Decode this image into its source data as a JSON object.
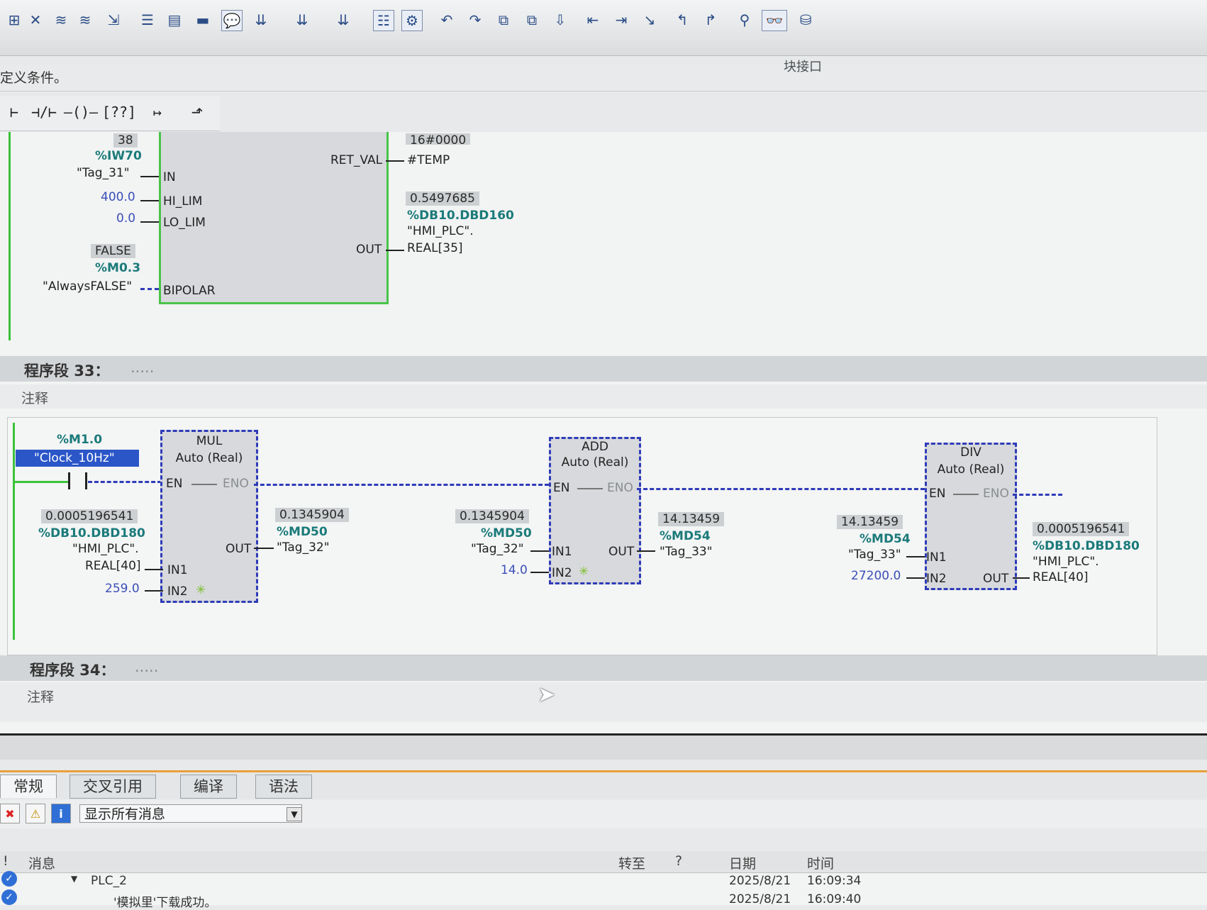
{
  "toolbar": {
    "icons": [
      "set-reset-icon",
      "network-icon",
      "step-icon",
      "step2-icon",
      "goto-icon",
      "list-icon",
      "block-icon",
      "block2-icon",
      "comment-icon",
      "download-icon",
      "download2-icon",
      "download3-icon",
      "list2-icon",
      "monitor-icon",
      "arrow-icon",
      "arrow2-icon",
      "compare-icon",
      "compare2-icon",
      "compare3-icon",
      "indent-icon",
      "indent2-icon",
      "indent3-icon",
      "jump-icon",
      "jump2-icon",
      "search-icon",
      "glasses-icon",
      "db-icon"
    ],
    "block_interface": "块接口"
  },
  "info_text": "定义条件。",
  "palette": [
    "⊢",
    "⊣/⊢",
    "–()–",
    "[??]",
    "↦",
    "⬏"
  ],
  "network32": {
    "block": {
      "in_top_value": "38",
      "in_addr": "%IW70",
      "in_tag": "\"Tag_31\"",
      "in_pin": "IN",
      "hi_value": "400.0",
      "hi_pin": "HI_LIM",
      "lo_value": "0.0",
      "lo_pin": "LO_LIM",
      "bipolar_value": "FALSE",
      "bipolar_addr": "%M0.3",
      "bipolar_tag": "\"AlwaysFALSE\"",
      "bipolar_pin": "BIPOLAR",
      "ret_val_pin": "RET_VAL",
      "ret_val_top": "16#0000",
      "ret_val_tag": "#TEMP",
      "out_pin": "OUT",
      "out_value": "0.5497685",
      "out_addr": "%DB10.DBD160",
      "out_tag1": "\"HMI_PLC\".",
      "out_tag2": "REAL[35]"
    }
  },
  "network33": {
    "title": "程序段 33：",
    "title_dots": ".....",
    "comment": "注释",
    "contact_addr": "%M1.0",
    "contact_tag": "\"Clock_10Hz\"",
    "mul": {
      "name": "MUL",
      "type": "Auto (Real)",
      "en": "EN",
      "eno": "ENO",
      "in1": "IN1",
      "in2": "IN2",
      "out": "OUT",
      "in1_value": "0.0005196541",
      "in1_addr": "%DB10.DBD180",
      "in1_tag1": "\"HMI_PLC\".",
      "in1_tag2": "REAL[40]",
      "in2_const": "259.0",
      "out_value": "0.1345904",
      "out_addr": "%MD50",
      "out_tag": "\"Tag_32\""
    },
    "add": {
      "name": "ADD",
      "type": "Auto (Real)",
      "en": "EN",
      "eno": "ENO",
      "in1": "IN1",
      "in2": "IN2",
      "out": "OUT",
      "in1_value": "0.1345904",
      "in1_addr": "%MD50",
      "in1_tag": "\"Tag_32\"",
      "in2_const": "14.0",
      "out_value": "14.13459",
      "out_addr": "%MD54",
      "out_tag": "\"Tag_33\""
    },
    "div": {
      "name": "DIV",
      "type": "Auto (Real)",
      "en": "EN",
      "eno": "ENO",
      "in1": "IN1",
      "in2": "IN2",
      "out": "OUT",
      "in1_value": "14.13459",
      "in1_addr": "%MD54",
      "in1_tag": "\"Tag_33\"",
      "in2_const": "27200.0",
      "out_value": "0.0005196541",
      "out_addr": "%DB10.DBD180",
      "out_tag1": "\"HMI_PLC\".",
      "out_tag2": "REAL[40]"
    }
  },
  "network34": {
    "title": "程序段 34：",
    "title_dots": ".....",
    "comment": "注释"
  },
  "bottom": {
    "tabs": [
      "常规",
      "交叉引用",
      "编译",
      "语法"
    ],
    "filter_select": "显示所有消息",
    "columns": {
      "status": "!",
      "message": "消息",
      "goto": "转至",
      "q": "?",
      "date": "日期",
      "time": "时间"
    },
    "rows": [
      {
        "message": "PLC_2",
        "date": "2025/8/21",
        "time": "16:09:34"
      },
      {
        "message": "'模拟里'下载成功。",
        "date": "2025/8/21",
        "time": "16:09:40"
      }
    ]
  }
}
